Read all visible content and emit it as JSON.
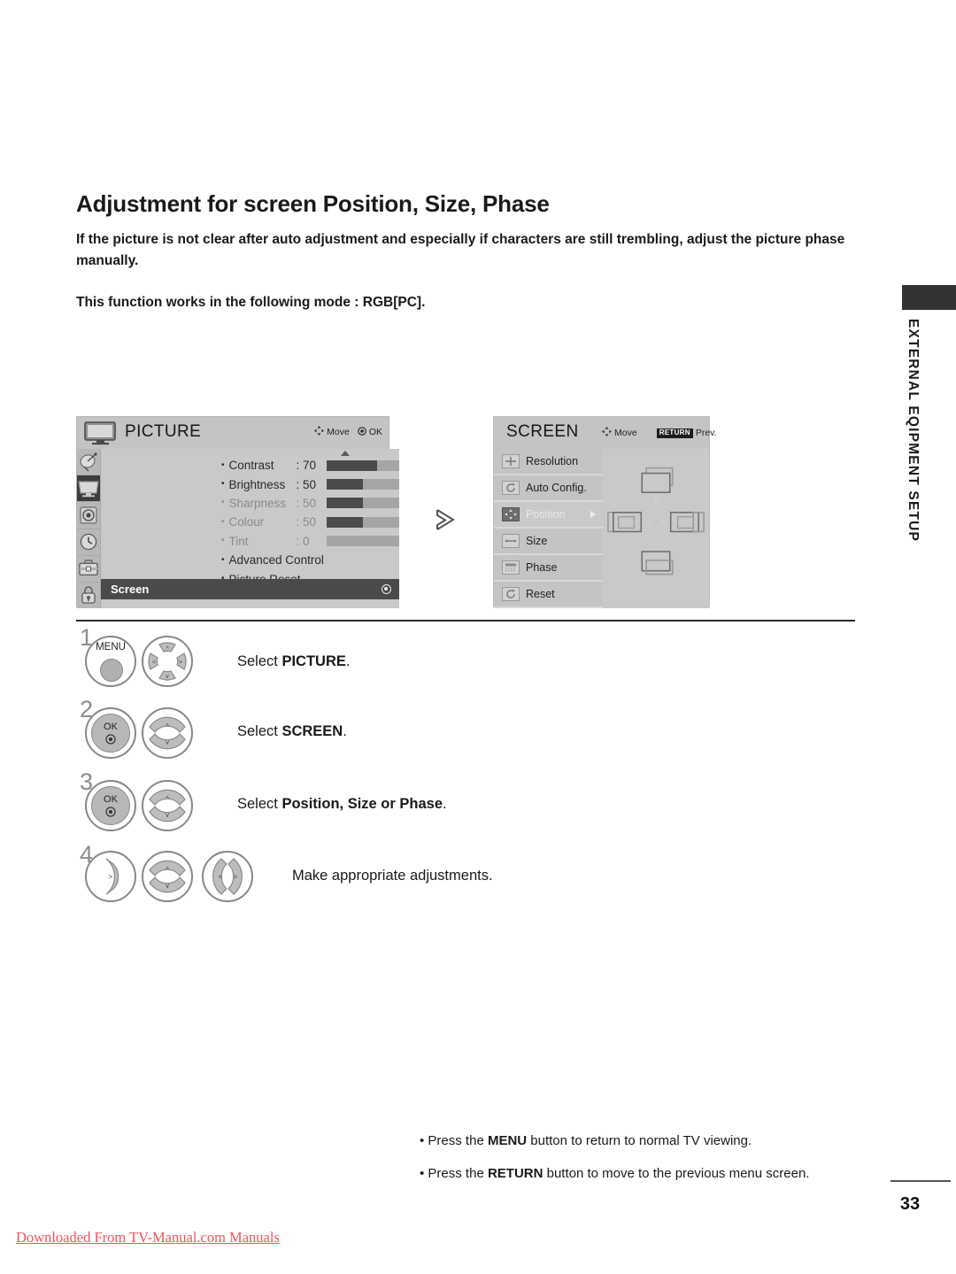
{
  "page": {
    "title": "Adjustment for screen Position, Size, Phase",
    "intro": "If the picture is not clear after auto adjustment and especially if characters are still trembling, adjust the picture phase manually.",
    "mode_line": "This function works in the following mode : RGB[PC].",
    "number": "33",
    "side_tab": "EXTERNAL EQIPMENT SETUP",
    "download_note": "Downloaded From TV-Manual.com Manuals"
  },
  "picture_osd": {
    "title": "PICTURE",
    "hints": [
      {
        "icon": "move-icon",
        "label": "Move"
      },
      {
        "icon": "ok-dot-icon",
        "label": "OK"
      }
    ],
    "rail": [
      {
        "name": "setup-icon",
        "active": false
      },
      {
        "name": "picture-icon",
        "active": true
      },
      {
        "name": "audio-icon",
        "active": false
      },
      {
        "name": "time-icon",
        "active": false
      },
      {
        "name": "option-icon",
        "active": false
      },
      {
        "name": "lock-icon",
        "active": false
      }
    ],
    "items": [
      {
        "label": "Contrast",
        "colon": ": 70",
        "value": 70,
        "bar": true,
        "dim": false
      },
      {
        "label": "Brightness",
        "colon": ": 50",
        "value": 50,
        "bar": true,
        "dim": false
      },
      {
        "label": "Sharpness",
        "colon": ": 50",
        "value": 50,
        "bar": true,
        "dim": true
      },
      {
        "label": "Colour",
        "colon": ": 50",
        "value": 50,
        "bar": true,
        "dim": true
      },
      {
        "label": "Tint",
        "colon": ": 0",
        "value": 0,
        "bar": true,
        "dim": true
      },
      {
        "label": "Advanced Control",
        "colon": "",
        "value": null,
        "bar": false,
        "dim": false
      },
      {
        "label": "Picture Reset",
        "colon": "",
        "value": null,
        "bar": false,
        "dim": false
      }
    ],
    "selected_row": "Screen"
  },
  "screen_osd": {
    "title": "SCREEN",
    "hints": [
      {
        "icon": "move-icon",
        "label": "Move"
      },
      {
        "icon": "return-badge",
        "badge": "RETURN",
        "label": "Prev."
      }
    ],
    "items": [
      {
        "label": "Resolution",
        "icon": "resolution-icon",
        "active": false
      },
      {
        "label": "Auto Config.",
        "icon": "auto-config-icon",
        "active": false
      },
      {
        "label": "Position",
        "icon": "position-icon",
        "active": true
      },
      {
        "label": "Size",
        "icon": "size-icon",
        "active": false
      },
      {
        "label": "Phase",
        "icon": "phase-icon",
        "active": false
      },
      {
        "label": "Reset",
        "icon": "reset-icon",
        "active": false
      }
    ]
  },
  "steps": [
    {
      "num": "1",
      "buttons": [
        "MENU",
        "dpad"
      ],
      "text_prefix": "Select ",
      "text_bold": "PICTURE",
      "text_suffix": "."
    },
    {
      "num": "2",
      "buttons": [
        "OK",
        "updown"
      ],
      "text_prefix": "Select ",
      "text_bold": "SCREEN",
      "text_suffix": "."
    },
    {
      "num": "3",
      "buttons": [
        "OK",
        "updown"
      ],
      "text_prefix": "Select ",
      "text_bold": "Position, Size or Phase",
      "text_suffix": "."
    },
    {
      "num": "4",
      "buttons": [
        "right",
        "updown",
        "leftright"
      ],
      "text_prefix": "Make appropriate adjustments.",
      "text_bold": "",
      "text_suffix": ""
    }
  ],
  "step_labels": {
    "menu": "MENU",
    "ok": "OK"
  },
  "notes": [
    {
      "pre": "• Press the ",
      "bold": "MENU",
      "post": " button to return to normal TV viewing."
    },
    {
      "pre": "• Press the ",
      "bold": "RETURN",
      "post": " button to move to the previous menu screen."
    }
  ],
  "colors": {
    "accent_red": "#f4545a",
    "osd_bg": "#c9c9c9",
    "osd_selected": "#4a4a4a"
  }
}
